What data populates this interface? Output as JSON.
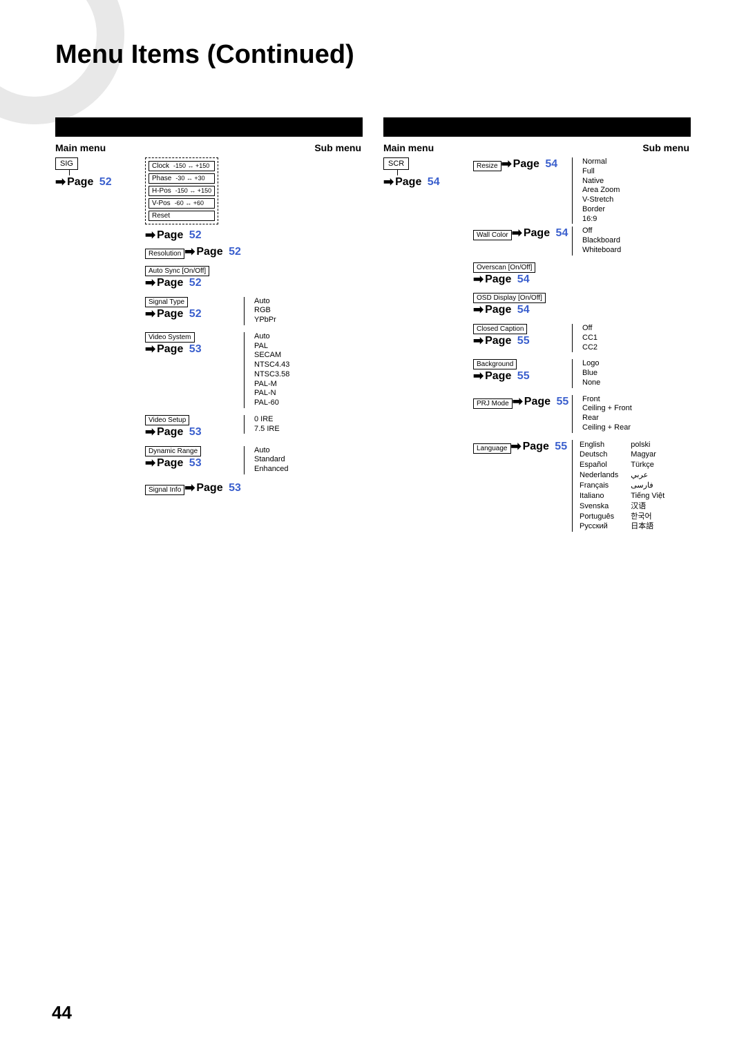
{
  "page_title": "Menu Items (Continued)",
  "page_number": "44",
  "left": {
    "headers": {
      "main": "Main menu",
      "sub": "Sub menu"
    },
    "root": "SIG",
    "group_dashed": [
      {
        "label": "Clock",
        "range": "-150 ↔ +150"
      },
      {
        "label": "Phase",
        "range": "-30 ↔ +30"
      },
      {
        "label": "H-Pos",
        "range": "-150 ↔ +150"
      },
      {
        "label": "V-Pos",
        "range": "-60 ↔ +60"
      },
      {
        "label": "Reset",
        "range": ""
      }
    ],
    "ref1": {
      "word": "Page",
      "num": "52"
    },
    "ref2": {
      "word": "Page",
      "num": "52"
    },
    "items": [
      {
        "label": "Resolution",
        "ref": {
          "word": "Page",
          "num": "52"
        },
        "subs": []
      },
      {
        "label": "Auto Sync [On/Off]",
        "ref": {
          "word": "Page",
          "num": "52"
        },
        "subs": []
      },
      {
        "label": "Signal Type",
        "ref": {
          "word": "Page",
          "num": "52"
        },
        "subs": [
          "Auto",
          "RGB",
          "YPbPr"
        ]
      },
      {
        "label": "Video System",
        "ref": {
          "word": "Page",
          "num": "53"
        },
        "subs": [
          "Auto",
          "PAL",
          "SECAM",
          "NTSC4.43",
          "NTSC3.58",
          "PAL-M",
          "PAL-N",
          "PAL-60"
        ]
      },
      {
        "label": "Video Setup",
        "ref": {
          "word": "Page",
          "num": "53"
        },
        "subs": [
          "0 IRE",
          "7.5 IRE"
        ]
      },
      {
        "label": "Dynamic Range",
        "ref": {
          "word": "Page",
          "num": "53"
        },
        "subs": [
          "Auto",
          "Standard",
          "Enhanced"
        ]
      },
      {
        "label": "Signal Info",
        "ref": {
          "word": "Page",
          "num": "53"
        },
        "subs": []
      }
    ]
  },
  "right": {
    "headers": {
      "main": "Main menu",
      "sub": "Sub menu"
    },
    "root": "SCR",
    "ref_root": {
      "word": "Page",
      "num": "54"
    },
    "items": [
      {
        "label": "Resize",
        "ref": {
          "word": "Page",
          "num": "54"
        },
        "subs": [
          "Normal",
          "Full",
          "Native",
          "Area Zoom",
          "V-Stretch",
          "Border",
          "16:9"
        ]
      },
      {
        "label": "Wall Color",
        "ref": {
          "word": "Page",
          "num": "54"
        },
        "subs": [
          "Off",
          "Blackboard",
          "Whiteboard"
        ]
      },
      {
        "label": "Overscan [On/Off]",
        "ref": {
          "word": "Page",
          "num": "54"
        },
        "subs": []
      },
      {
        "label": "OSD Display [On/Off]",
        "ref": {
          "word": "Page",
          "num": "54"
        },
        "subs": []
      },
      {
        "label": "Closed Caption",
        "ref": {
          "word": "Page",
          "num": "55"
        },
        "subs": [
          "Off",
          "CC1",
          "CC2"
        ]
      },
      {
        "label": "Background",
        "ref": {
          "word": "Page",
          "num": "55"
        },
        "subs": [
          "Logo",
          "Blue",
          "None"
        ]
      },
      {
        "label": "PRJ Mode",
        "ref": {
          "word": "Page",
          "num": "55"
        },
        "subs": [
          "Front",
          "Ceiling + Front",
          "Rear",
          "Ceiling + Rear"
        ]
      },
      {
        "label": "Language",
        "ref": {
          "word": "Page",
          "num": "55"
        },
        "langs": {
          "col1": [
            "English",
            "Deutsch",
            "Español",
            "Nederlands",
            "Français",
            "Italiano",
            "Svenska",
            "Português",
            "Русский"
          ],
          "col2": [
            "polski",
            "Magyar",
            "Türkçe",
            "عربي",
            "فارسی",
            "Tiếng Việt",
            "汉语",
            "한국어",
            "日本語"
          ]
        }
      }
    ]
  }
}
